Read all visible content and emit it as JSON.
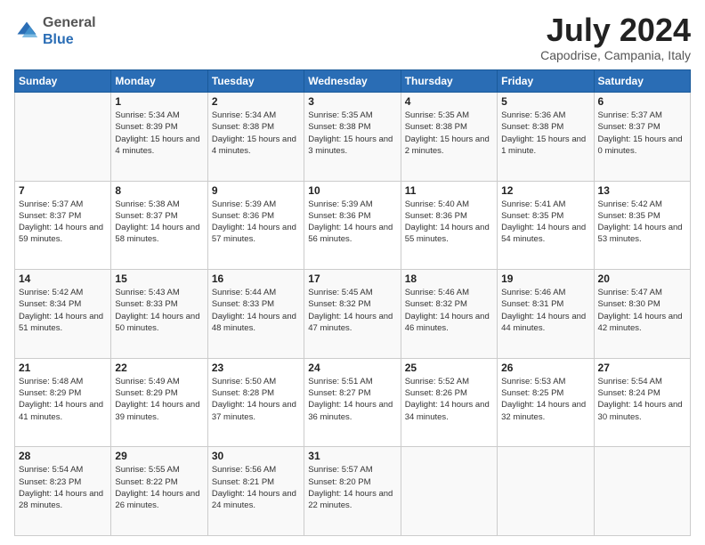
{
  "header": {
    "logo_general": "General",
    "logo_blue": "Blue",
    "month_title": "July 2024",
    "subtitle": "Capodrise, Campania, Italy"
  },
  "weekdays": [
    "Sunday",
    "Monday",
    "Tuesday",
    "Wednesday",
    "Thursday",
    "Friday",
    "Saturday"
  ],
  "weeks": [
    [
      {
        "day": "",
        "sunrise": "",
        "sunset": "",
        "daylight": ""
      },
      {
        "day": "1",
        "sunrise": "Sunrise: 5:34 AM",
        "sunset": "Sunset: 8:39 PM",
        "daylight": "Daylight: 15 hours and 4 minutes."
      },
      {
        "day": "2",
        "sunrise": "Sunrise: 5:34 AM",
        "sunset": "Sunset: 8:38 PM",
        "daylight": "Daylight: 15 hours and 4 minutes."
      },
      {
        "day": "3",
        "sunrise": "Sunrise: 5:35 AM",
        "sunset": "Sunset: 8:38 PM",
        "daylight": "Daylight: 15 hours and 3 minutes."
      },
      {
        "day": "4",
        "sunrise": "Sunrise: 5:35 AM",
        "sunset": "Sunset: 8:38 PM",
        "daylight": "Daylight: 15 hours and 2 minutes."
      },
      {
        "day": "5",
        "sunrise": "Sunrise: 5:36 AM",
        "sunset": "Sunset: 8:38 PM",
        "daylight": "Daylight: 15 hours and 1 minute."
      },
      {
        "day": "6",
        "sunrise": "Sunrise: 5:37 AM",
        "sunset": "Sunset: 8:37 PM",
        "daylight": "Daylight: 15 hours and 0 minutes."
      }
    ],
    [
      {
        "day": "7",
        "sunrise": "Sunrise: 5:37 AM",
        "sunset": "Sunset: 8:37 PM",
        "daylight": "Daylight: 14 hours and 59 minutes."
      },
      {
        "day": "8",
        "sunrise": "Sunrise: 5:38 AM",
        "sunset": "Sunset: 8:37 PM",
        "daylight": "Daylight: 14 hours and 58 minutes."
      },
      {
        "day": "9",
        "sunrise": "Sunrise: 5:39 AM",
        "sunset": "Sunset: 8:36 PM",
        "daylight": "Daylight: 14 hours and 57 minutes."
      },
      {
        "day": "10",
        "sunrise": "Sunrise: 5:39 AM",
        "sunset": "Sunset: 8:36 PM",
        "daylight": "Daylight: 14 hours and 56 minutes."
      },
      {
        "day": "11",
        "sunrise": "Sunrise: 5:40 AM",
        "sunset": "Sunset: 8:36 PM",
        "daylight": "Daylight: 14 hours and 55 minutes."
      },
      {
        "day": "12",
        "sunrise": "Sunrise: 5:41 AM",
        "sunset": "Sunset: 8:35 PM",
        "daylight": "Daylight: 14 hours and 54 minutes."
      },
      {
        "day": "13",
        "sunrise": "Sunrise: 5:42 AM",
        "sunset": "Sunset: 8:35 PM",
        "daylight": "Daylight: 14 hours and 53 minutes."
      }
    ],
    [
      {
        "day": "14",
        "sunrise": "Sunrise: 5:42 AM",
        "sunset": "Sunset: 8:34 PM",
        "daylight": "Daylight: 14 hours and 51 minutes."
      },
      {
        "day": "15",
        "sunrise": "Sunrise: 5:43 AM",
        "sunset": "Sunset: 8:33 PM",
        "daylight": "Daylight: 14 hours and 50 minutes."
      },
      {
        "day": "16",
        "sunrise": "Sunrise: 5:44 AM",
        "sunset": "Sunset: 8:33 PM",
        "daylight": "Daylight: 14 hours and 48 minutes."
      },
      {
        "day": "17",
        "sunrise": "Sunrise: 5:45 AM",
        "sunset": "Sunset: 8:32 PM",
        "daylight": "Daylight: 14 hours and 47 minutes."
      },
      {
        "day": "18",
        "sunrise": "Sunrise: 5:46 AM",
        "sunset": "Sunset: 8:32 PM",
        "daylight": "Daylight: 14 hours and 46 minutes."
      },
      {
        "day": "19",
        "sunrise": "Sunrise: 5:46 AM",
        "sunset": "Sunset: 8:31 PM",
        "daylight": "Daylight: 14 hours and 44 minutes."
      },
      {
        "day": "20",
        "sunrise": "Sunrise: 5:47 AM",
        "sunset": "Sunset: 8:30 PM",
        "daylight": "Daylight: 14 hours and 42 minutes."
      }
    ],
    [
      {
        "day": "21",
        "sunrise": "Sunrise: 5:48 AM",
        "sunset": "Sunset: 8:29 PM",
        "daylight": "Daylight: 14 hours and 41 minutes."
      },
      {
        "day": "22",
        "sunrise": "Sunrise: 5:49 AM",
        "sunset": "Sunset: 8:29 PM",
        "daylight": "Daylight: 14 hours and 39 minutes."
      },
      {
        "day": "23",
        "sunrise": "Sunrise: 5:50 AM",
        "sunset": "Sunset: 8:28 PM",
        "daylight": "Daylight: 14 hours and 37 minutes."
      },
      {
        "day": "24",
        "sunrise": "Sunrise: 5:51 AM",
        "sunset": "Sunset: 8:27 PM",
        "daylight": "Daylight: 14 hours and 36 minutes."
      },
      {
        "day": "25",
        "sunrise": "Sunrise: 5:52 AM",
        "sunset": "Sunset: 8:26 PM",
        "daylight": "Daylight: 14 hours and 34 minutes."
      },
      {
        "day": "26",
        "sunrise": "Sunrise: 5:53 AM",
        "sunset": "Sunset: 8:25 PM",
        "daylight": "Daylight: 14 hours and 32 minutes."
      },
      {
        "day": "27",
        "sunrise": "Sunrise: 5:54 AM",
        "sunset": "Sunset: 8:24 PM",
        "daylight": "Daylight: 14 hours and 30 minutes."
      }
    ],
    [
      {
        "day": "28",
        "sunrise": "Sunrise: 5:54 AM",
        "sunset": "Sunset: 8:23 PM",
        "daylight": "Daylight: 14 hours and 28 minutes."
      },
      {
        "day": "29",
        "sunrise": "Sunrise: 5:55 AM",
        "sunset": "Sunset: 8:22 PM",
        "daylight": "Daylight: 14 hours and 26 minutes."
      },
      {
        "day": "30",
        "sunrise": "Sunrise: 5:56 AM",
        "sunset": "Sunset: 8:21 PM",
        "daylight": "Daylight: 14 hours and 24 minutes."
      },
      {
        "day": "31",
        "sunrise": "Sunrise: 5:57 AM",
        "sunset": "Sunset: 8:20 PM",
        "daylight": "Daylight: 14 hours and 22 minutes."
      },
      {
        "day": "",
        "sunrise": "",
        "sunset": "",
        "daylight": ""
      },
      {
        "day": "",
        "sunrise": "",
        "sunset": "",
        "daylight": ""
      },
      {
        "day": "",
        "sunrise": "",
        "sunset": "",
        "daylight": ""
      }
    ]
  ]
}
